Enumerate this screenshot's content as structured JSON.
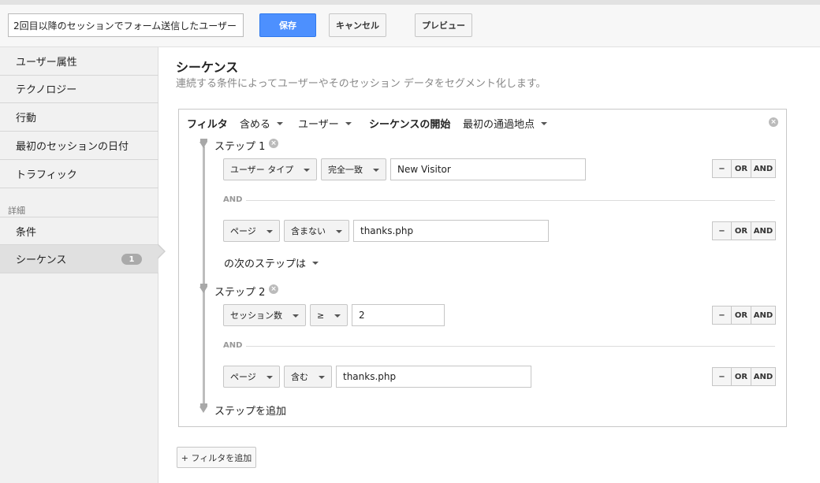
{
  "header": {
    "segment_name": "2回目以降のセッションでフォーム送信したユーザー",
    "save_label": "保存",
    "cancel_label": "キャンセル",
    "preview_label": "プレビュー"
  },
  "sidebar": {
    "items": [
      {
        "label": "ユーザー属性"
      },
      {
        "label": "テクノロジー"
      },
      {
        "label": "行動"
      },
      {
        "label": "最初のセッションの日付"
      },
      {
        "label": "トラフィック"
      }
    ],
    "advanced_heading": "詳細",
    "advanced_items": [
      {
        "label": "条件"
      },
      {
        "label": "シーケンス",
        "badge": "1"
      }
    ]
  },
  "main": {
    "title": "シーケンス",
    "subtitle": "連続する条件によってユーザーやそのセッション データをセグメント化します。"
  },
  "filter": {
    "label": "フィルタ",
    "include": "含める",
    "scope": "ユーザー",
    "sequence_start_label": "シーケンスの開始",
    "sequence_start_value": "最初の通過地点",
    "steps": [
      {
        "label": "ステップ 1",
        "conditions": [
          {
            "dimension": "ユーザー タイプ",
            "operator": "完全一致",
            "value": "New Visitor"
          },
          {
            "dimension": "ページ",
            "operator": "含まない",
            "value": "thanks.php"
          }
        ]
      },
      {
        "label": "ステップ 2",
        "conditions": [
          {
            "dimension": "セッション数",
            "operator": "≥",
            "value": "2"
          },
          {
            "dimension": "ページ",
            "operator": "含む",
            "value": "thanks.php"
          }
        ]
      }
    ],
    "and_label": "AND",
    "next_step_label": "の次のステップは",
    "add_step_label": "ステップを追加",
    "control_minus": "−",
    "control_or": "OR",
    "control_and": "AND",
    "remove_symbol": "×"
  },
  "footer": {
    "add_filter_label": "+ フィルタを追加"
  }
}
